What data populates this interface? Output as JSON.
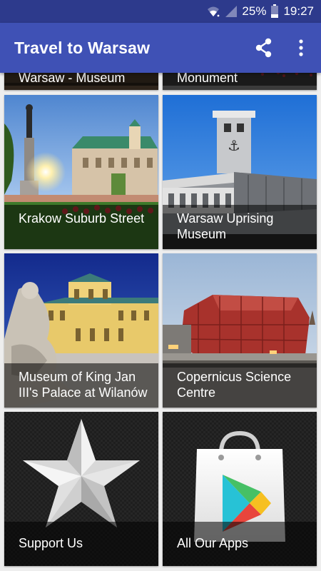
{
  "status_bar": {
    "battery": "25%",
    "time": "19:27"
  },
  "app_bar": {
    "title": "Travel to Warsaw"
  },
  "tiles": [
    {
      "label": "Warsaw - Museum"
    },
    {
      "label": "Monument"
    },
    {
      "label": "Krakow Suburb Street"
    },
    {
      "label": "Warsaw Uprising Museum"
    },
    {
      "label": "Museum of King Jan III's Palace at Wilanów"
    },
    {
      "label": "Copernicus Science Centre"
    },
    {
      "label": "Support Us"
    },
    {
      "label": "All Our Apps"
    }
  ],
  "colors": {
    "primary": "#3f51b5",
    "status_bar": "#2d3a8c",
    "background": "#eeeeee"
  }
}
